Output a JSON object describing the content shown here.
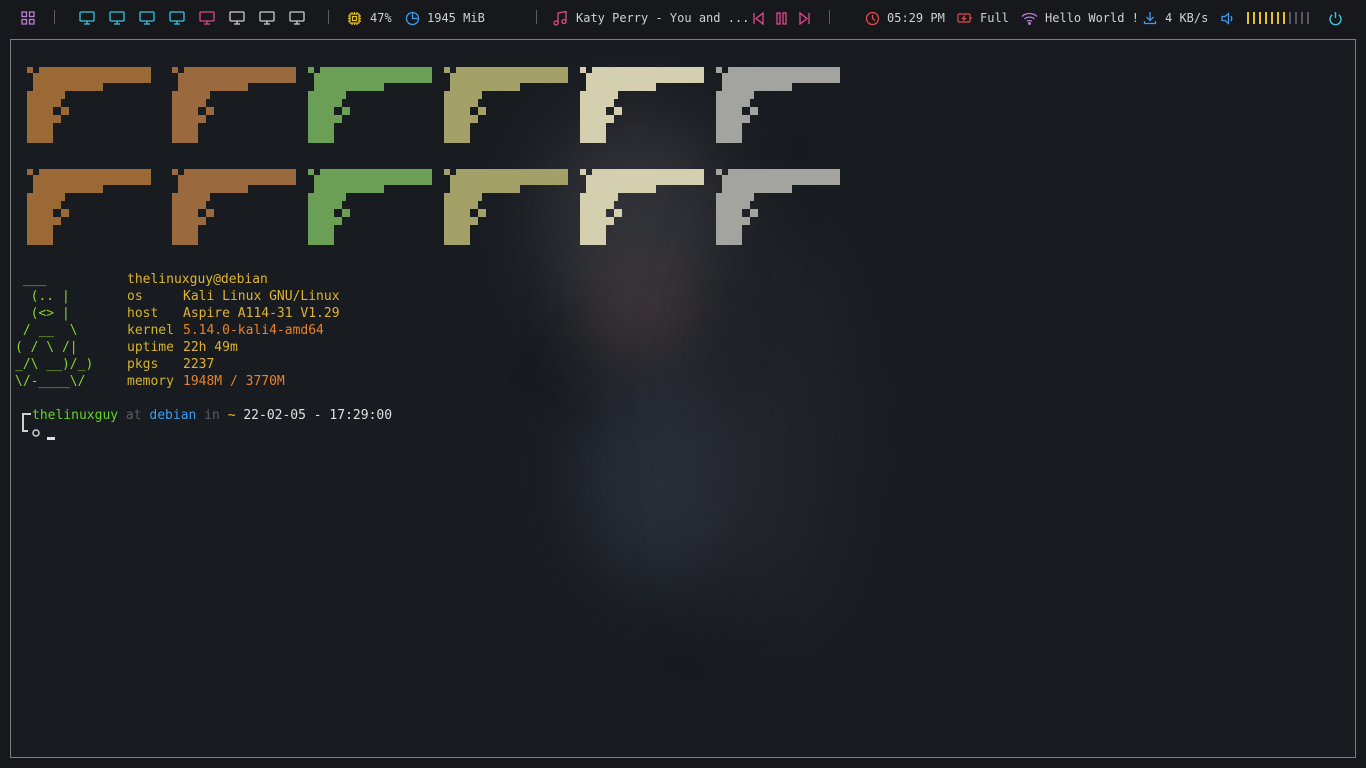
{
  "bar": {
    "cpu": "47%",
    "memory": "1945 MiB",
    "music": "Katy Perry - You and ...",
    "clock": "05:29 PM",
    "battery": "Full",
    "wifi": "Hello World !",
    "net_speed": "4 KB/s"
  },
  "colors": {
    "cyan": "#38c6e0",
    "pink": "#e04a8c",
    "yellow": "#e8c22a",
    "lime": "#87d42b",
    "orange": "#e8822a",
    "prompt_green": "#64d228",
    "prompt_blue": "#3d9bef",
    "guns": [
      "#9a6936",
      "#9a6a3e",
      "#6a9f55",
      "#a3a168",
      "#d3cfaf",
      "#a3a3a0"
    ]
  },
  "icons": [
    "apps-grid-icon",
    "monitor-icon",
    "cpu-icon",
    "memory-pie-icon",
    "music-note-icon",
    "prev-track-icon",
    "pause-icon",
    "next-track-icon",
    "clock-icon",
    "battery-icon",
    "wifi-icon",
    "download-icon",
    "volume-icon",
    "power-icon"
  ],
  "volume": {
    "level": 0.6,
    "segments": 11
  },
  "fetch": {
    "ascii": [
      " ___",
      "  (.. |",
      "  (<> |",
      " / __  \\",
      "( / \\ /|",
      "_/\\ __)/_)",
      "\\/-____\\/"
    ],
    "title": "thelinuxguy@debian",
    "rows": [
      {
        "label": "os",
        "value": "Kali Linux GNU/Linux"
      },
      {
        "label": "host",
        "value": "Aspire A114-31 V1.29"
      },
      {
        "label": "kernel",
        "value": "5.14.0-kali4-amd64"
      },
      {
        "label": "uptime",
        "value": "22h 49m"
      },
      {
        "label": "pkgs",
        "value": "2237"
      },
      {
        "label": "memory",
        "value": "1948M / 3770M"
      }
    ]
  },
  "prompt": {
    "user": "thelinuxguy",
    "at": "at",
    "host": "debian",
    "in": "in",
    "dir": "~",
    "datetime": "22-02-05 - 17:29:00"
  }
}
